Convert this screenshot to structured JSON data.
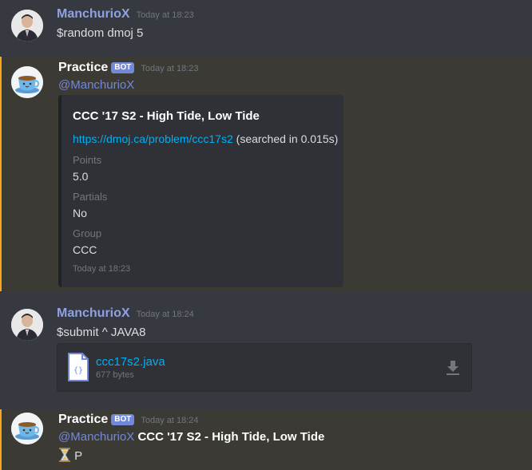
{
  "messages": [
    {
      "author": "ManchurioX",
      "timestamp": "Today at 18:23",
      "text": "$random dmoj 5"
    },
    {
      "author": "Practice",
      "badge": "BOT",
      "timestamp": "Today at 18:23",
      "mention": "@ManchurioX",
      "embed": {
        "title": "CCC '17 S2 - High Tide, Low Tide",
        "link": "https://dmoj.ca/problem/ccc17s2",
        "link_suffix": "(searched in 0.015s)",
        "fields": [
          {
            "name": "Points",
            "value": "5.0"
          },
          {
            "name": "Partials",
            "value": "No"
          },
          {
            "name": "Group",
            "value": "CCC"
          }
        ],
        "footer": "Today at 18:23"
      }
    },
    {
      "author": "ManchurioX",
      "timestamp": "Today at 18:24",
      "text": "$submit ^ JAVA8",
      "attachment": {
        "filename": "ccc17s2.java",
        "size": "677 bytes",
        "icon": "code-file-icon"
      }
    },
    {
      "author": "Practice",
      "badge": "BOT",
      "timestamp": "Today at 18:24",
      "mention": "@ManchurioX",
      "bold_text": "CCC '17 S2 - High Tide, Low Tide",
      "status_icon": "hourglass-icon",
      "status_text": "P"
    }
  ],
  "colors": {
    "background": "#36393f",
    "highlight": "#3b3a34",
    "highlight_border": "#faa61a",
    "link": "#00b0f4",
    "mention": "#7289da"
  }
}
